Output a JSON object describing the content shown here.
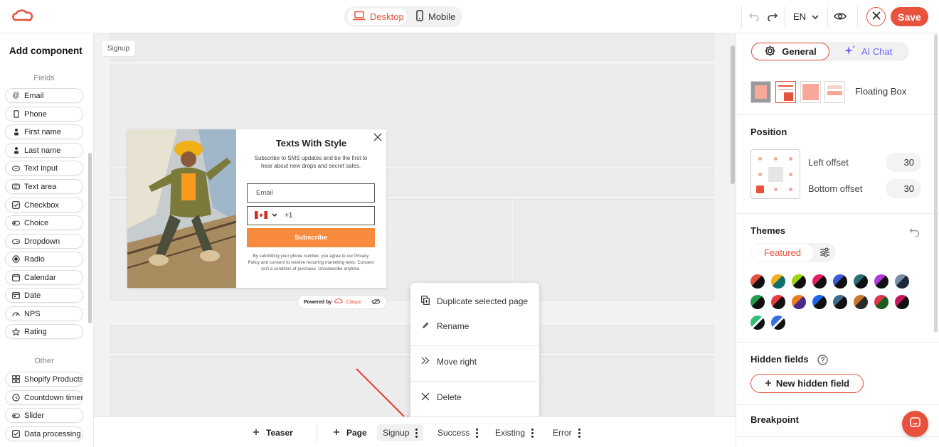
{
  "topbar": {
    "devices": {
      "desktop": "Desktop",
      "mobile": "Mobile"
    },
    "language": "EN",
    "save_label": "Save",
    "accent": "#e8513b"
  },
  "sidebar": {
    "title": "Add component",
    "fields_label": "Fields",
    "fields": [
      {
        "label": "Email",
        "icon": "at-icon"
      },
      {
        "label": "Phone",
        "icon": "phone-icon"
      },
      {
        "label": "First name",
        "icon": "person-icon"
      },
      {
        "label": "Last name",
        "icon": "person-icon"
      },
      {
        "label": "Text input",
        "icon": "text-input-icon"
      },
      {
        "label": "Text area",
        "icon": "text-area-icon"
      },
      {
        "label": "Checkbox",
        "icon": "checkbox-icon"
      },
      {
        "label": "Choice",
        "icon": "toggle-icon"
      },
      {
        "label": "Dropdown",
        "icon": "dropdown-icon"
      },
      {
        "label": "Radio",
        "icon": "radio-icon"
      },
      {
        "label": "Calendar",
        "icon": "calendar-icon"
      },
      {
        "label": "Date",
        "icon": "date-icon"
      },
      {
        "label": "NPS",
        "icon": "gauge-icon"
      },
      {
        "label": "Rating",
        "icon": "star-icon"
      }
    ],
    "other_label": "Other",
    "other": [
      {
        "label": "Shopify Products",
        "icon": "grid-icon"
      },
      {
        "label": "Countdown timer",
        "icon": "timer-icon"
      },
      {
        "label": "Slider",
        "icon": "slider-icon"
      },
      {
        "label": "Data processing",
        "icon": "checkbox-icon"
      }
    ]
  },
  "canvas": {
    "page_tag": "Signup",
    "popup": {
      "title": "Texts With Style",
      "description": "Subscribe to SMS updates and be the first to hear about new drops and secret sales.",
      "email_placeholder": "Email",
      "phone_prefix": "+1",
      "subscribe_label": "Subscribe",
      "legal": "By submitting your phone number, you agree to our Privacy Policy and consent to receive recurring marketing texts. Consent isn't a condition of purchase. Unsubscribe anytime."
    },
    "powered_by": "Powered by",
    "brand": "Claspo"
  },
  "context_menu": {
    "items": [
      "Duplicate selected page",
      "Rename",
      "Move right",
      "Delete"
    ]
  },
  "bottom_tabs": {
    "teaser": "Teaser",
    "page": "Page",
    "pages": [
      "Signup",
      "Success",
      "Existing",
      "Error"
    ]
  },
  "right_panel": {
    "tabs": {
      "general": "General",
      "ai_chat": "AI Chat"
    },
    "layout_name": "Floating Box",
    "position": {
      "title": "Position",
      "left_offset_label": "Left offset",
      "left_offset": "30",
      "bottom_offset_label": "Bottom offset",
      "bottom_offset": "30"
    },
    "themes": {
      "title": "Themes",
      "filter": "Featured"
    },
    "hidden_fields": {
      "title": "Hidden fields",
      "button": "New hidden field"
    },
    "breakpoint": {
      "title": "Breakpoint"
    }
  }
}
